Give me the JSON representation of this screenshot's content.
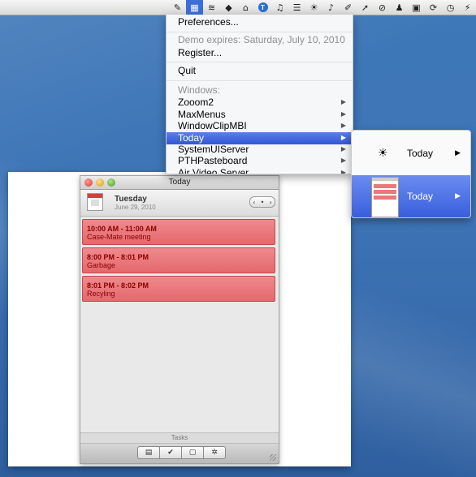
{
  "menubar": {
    "icons": [
      "script-icon",
      "calendar-icon",
      "wifi-icon",
      "dropbox-icon",
      "arch-icon",
      "t-icon",
      "music-note-icon",
      "list-icon",
      "brightness-icon",
      "headphones-icon",
      "feather-icon",
      "cursor-icon",
      "compass-icon",
      "bell-icon",
      "color-palette-icon",
      "sync-icon",
      "time-machine-icon",
      "bolt-icon"
    ],
    "t_badge": "T"
  },
  "menu": {
    "preferences": "Preferences...",
    "demo_expires": "Demo expires: Saturday, July 10, 2010",
    "register": "Register...",
    "quit": "Quit",
    "windows_header": "Windows:",
    "windows": [
      {
        "label": "Zooom2",
        "highlighted": false
      },
      {
        "label": "MaxMenus",
        "highlighted": false
      },
      {
        "label": "WindowClipMBI",
        "highlighted": false
      },
      {
        "label": "Today",
        "highlighted": true
      },
      {
        "label": "SystemUIServer",
        "highlighted": false
      },
      {
        "label": "PTHPasteboard",
        "highlighted": false
      },
      {
        "label": "Air Video Server",
        "highlighted": false
      }
    ]
  },
  "submenu": {
    "items": [
      {
        "label": "Today",
        "icon": "sun-icon",
        "highlighted": false
      },
      {
        "label": "Today",
        "icon": "window-thumbnail",
        "highlighted": true
      }
    ]
  },
  "today_window": {
    "title": "Today",
    "day": "Tuesday",
    "date": "June 29, 2010",
    "events": [
      {
        "time": "10:00 AM - 11:00 AM",
        "title": "Case-Mate meeting"
      },
      {
        "time": "8:00 PM - 8:01 PM",
        "title": "Garbage"
      },
      {
        "time": "8:01 PM - 8:02 PM",
        "title": "Recyling"
      }
    ],
    "tasks_label": "Tasks",
    "toolbar_buttons": [
      "new-task-icon",
      "check-task-icon",
      "calendar-view-icon",
      "settings-icon"
    ]
  }
}
